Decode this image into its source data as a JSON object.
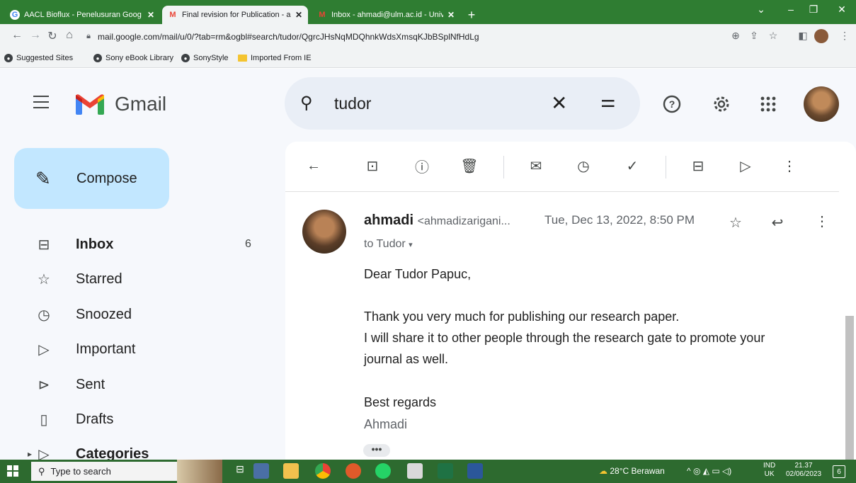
{
  "browser": {
    "tabs": [
      {
        "title": "AACL Bioflux - Penelusuran Goog",
        "active": false
      },
      {
        "title": "Final revision for Publication - ah",
        "active": true
      },
      {
        "title": "Inbox - ahmadi@ulm.ac.id - Univ",
        "active": false
      }
    ],
    "new_tab": "+",
    "url": "mail.google.com/mail/u/0/?tab=rm&ogbl#search/tudor/QgrcJHsNqMDQhnkWdsXmsqKJbBSplNfHdLg",
    "bookmarks": [
      "Suggested Sites",
      "Sony eBook Library",
      "SonyStyle",
      "Imported From IE"
    ],
    "colors": {
      "frame": "#2f7d32",
      "toolbar": "#f1f3f4"
    }
  },
  "gmail": {
    "brand": "Gmail",
    "search_value": "tudor",
    "compose_label": "Compose",
    "nav": [
      {
        "label": "Inbox",
        "count": "6",
        "icon": "inbox-icon",
        "bold": true
      },
      {
        "label": "Starred",
        "count": "",
        "icon": "star-icon",
        "bold": false
      },
      {
        "label": "Snoozed",
        "count": "",
        "icon": "clock-icon",
        "bold": false
      },
      {
        "label": "Important",
        "count": "",
        "icon": "important-icon",
        "bold": false
      },
      {
        "label": "Sent",
        "count": "",
        "icon": "send-icon",
        "bold": false
      },
      {
        "label": "Drafts",
        "count": "",
        "icon": "draft-icon",
        "bold": false
      },
      {
        "label": "Categories",
        "count": "",
        "icon": "label-icon",
        "bold": true
      }
    ],
    "colors": {
      "compose_bg": "#c2e7ff",
      "search_bg": "#e9eef6",
      "app_bg": "#f6f8fc"
    }
  },
  "message": {
    "sender_name": "ahmadi",
    "sender_email": "<ahmadizarigani...",
    "date": "Tue, Dec 13, 2022, 8:50 PM",
    "to": "to Tudor",
    "body": [
      "Dear Tudor Papuc,",
      "Thank you very much for publishing our research paper.",
      "I will share it to other people through the research gate to promote your",
      "journal as well.",
      "Best regards"
    ],
    "signature": "Ahmadi",
    "more": "•••"
  },
  "taskbar": {
    "search_placeholder": "Type to search",
    "weather": "28°C  Berawan",
    "lang": "IND",
    "locale": "UK",
    "time": "21.37",
    "date": "02/06/2023",
    "notifications": "6"
  }
}
